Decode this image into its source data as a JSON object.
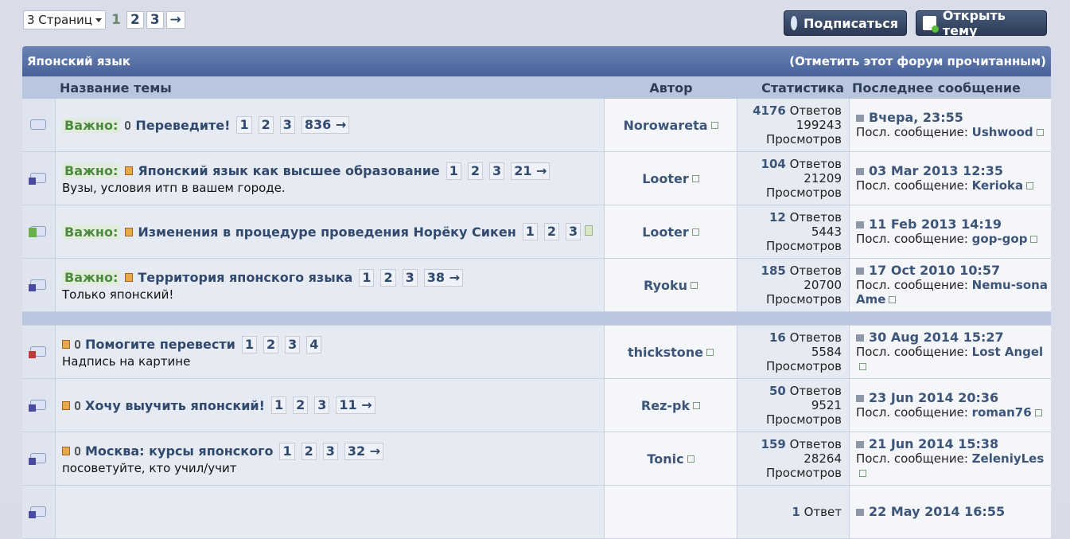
{
  "pager": {
    "dropdown": "3 Страниц",
    "current": "1",
    "pages": [
      "2",
      "3"
    ],
    "next": "→"
  },
  "buttons": {
    "subscribe": "Подписаться",
    "new_topic": "Открыть тему"
  },
  "forum": {
    "title": "Японский язык",
    "mark_read": "(Отметить этот форум прочитанным)"
  },
  "columns": {
    "title": "Название темы",
    "author": "Автор",
    "stats": "Статистика",
    "last": "Последнее сообщение"
  },
  "labels": {
    "important": "Важно:",
    "replies": "Ответов",
    "views": "Просмотров",
    "last_by": "Посл. сообщение:"
  },
  "rows": [
    {
      "important": true,
      "title": "Переведите!",
      "pages": [
        "1",
        "2",
        "3",
        "836 →"
      ],
      "desc": "",
      "author": "Norowareta",
      "replies": "4176",
      "views": "199243",
      "last_date": "Вчера, 23:55",
      "last_user": "Ushwood"
    },
    {
      "important": true,
      "title": "Японский язык как высшее образование",
      "pages": [
        "1",
        "2",
        "3",
        "21 →"
      ],
      "desc": "Вузы, условия итп в вашем городе.",
      "author": "Looter",
      "replies": "104",
      "views": "21209",
      "last_date": "03 Mar 2013 12:35",
      "last_user": "Kerioka"
    },
    {
      "important": true,
      "title": "Изменения в процедуре проведения Норёку Сикен",
      "pages": [
        "1",
        "2",
        "3"
      ],
      "desc": "",
      "author": "Looter",
      "replies": "12",
      "views": "5443",
      "last_date": "11 Feb 2013 14:19",
      "last_user": "gop-gop"
    },
    {
      "important": true,
      "title": "Территория японского языка",
      "pages": [
        "1",
        "2",
        "3",
        "38 →"
      ],
      "desc": "Только японский!",
      "author": "Ryoku",
      "replies": "185",
      "views": "20700",
      "last_date": "17 Oct 2010 10:57",
      "last_user": "Nemu-sona Ame"
    },
    {
      "important": false,
      "title": "Помогите перевести",
      "pages": [
        "1",
        "2",
        "3",
        "4"
      ],
      "desc": "Надпись на картине",
      "author": "thickstone",
      "replies": "16",
      "views": "5584",
      "last_date": "30 Aug 2014 15:27",
      "last_user": "Lost Angel"
    },
    {
      "important": false,
      "title": "Хочу выучить японский!",
      "pages": [
        "1",
        "2",
        "3",
        "11 →"
      ],
      "desc": "",
      "author": "Rez-pk",
      "replies": "50",
      "views": "9521",
      "last_date": "23 Jun 2014 20:36",
      "last_user": "roman76"
    },
    {
      "important": false,
      "title": "Москва: курсы японского",
      "pages": [
        "1",
        "2",
        "3",
        "32 →"
      ],
      "desc": "посоветуйте, кто учил/учит",
      "author": "Tonic",
      "replies": "159",
      "views": "28264",
      "last_date": "21 Jun 2014 15:38",
      "last_user": "ZeleniyLes"
    },
    {
      "important": false,
      "title": "",
      "pages": [],
      "desc": "",
      "author": "",
      "replies": "1",
      "views": "",
      "last_date": "22 May 2014 16:55",
      "last_user": ""
    }
  ],
  "reply_label_single": "Ответ"
}
